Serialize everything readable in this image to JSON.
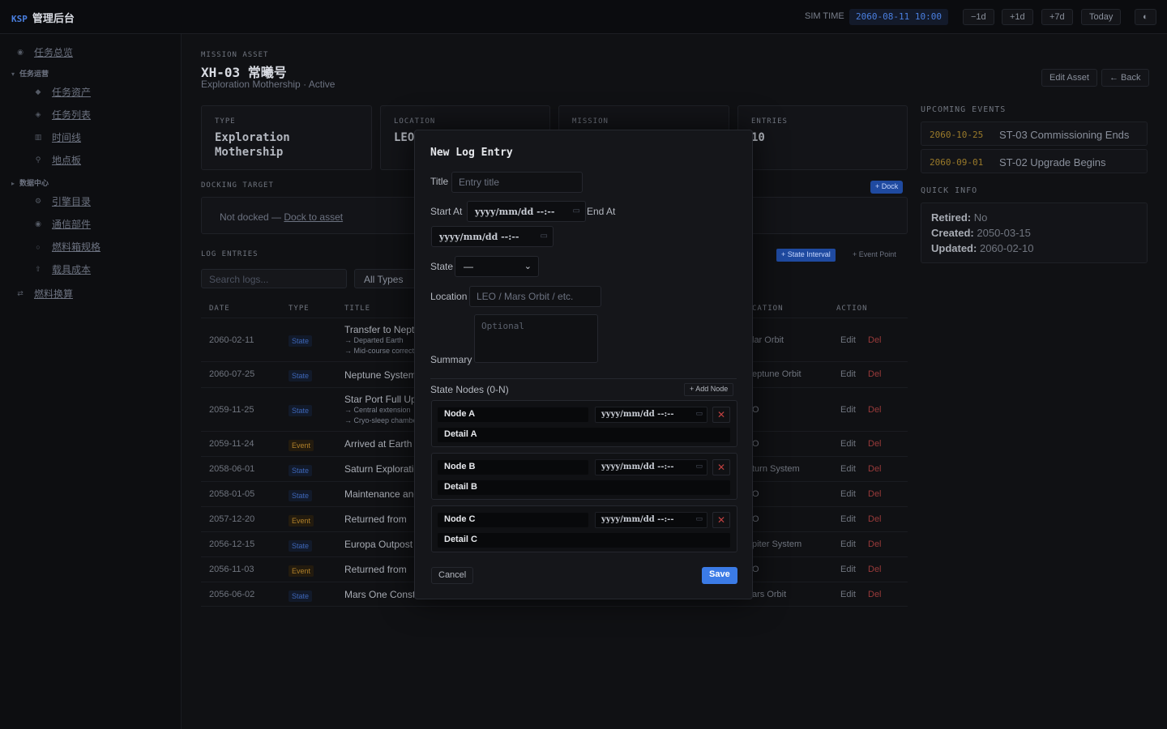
{
  "topbar": {
    "brand_code": "KSP",
    "brand_name": "管理后台",
    "sim_time_label": "SIM TIME",
    "sim_time": "2060-08-11 10:00",
    "buttons": [
      "−1d",
      "+1d",
      "+7d",
      "Today"
    ],
    "theme_icon": "◐"
  },
  "sidebar": {
    "overview": "任务总览",
    "group_ops": "任务运营",
    "ops_items": [
      "任务资产",
      "任务列表",
      "时间线",
      "地点板"
    ],
    "group_data": "数据中心",
    "data_items": [
      "引擎目录",
      "通信部件",
      "燃料箱规格",
      "载具成本"
    ],
    "fuel_calc": "燃料换算"
  },
  "header": {
    "eyebrow": "MISSION ASSET",
    "title": "XH-03 常曦号",
    "subtitle": "Exploration Mothership · Active",
    "edit_label": "Edit Asset",
    "back_label": "← Back"
  },
  "cards": [
    {
      "key": "TYPE",
      "value": "Exploration Mothership"
    },
    {
      "key": "LOCATION",
      "value": "LEO"
    },
    {
      "key": "MISSION",
      "value": ""
    },
    {
      "key": "ENTRIES",
      "value": "10"
    }
  ],
  "docking": {
    "heading": "DOCKING TARGET",
    "status": "Not docked — ",
    "link": "Dock to asset",
    "dock_button": "+ Dock"
  },
  "log": {
    "heading": "LOG ENTRIES",
    "search_placeholder": "Search logs...",
    "type_filter": "All Types",
    "state_interval_btn": "+ State Interval",
    "event_point_btn": "+ Event Point",
    "columns": {
      "date": "DATE",
      "type": "TYPE",
      "title": "TITLE",
      "location": "CATION",
      "action": "ACTION"
    },
    "edit_label": "Edit",
    "del_label": "Del",
    "rows": [
      {
        "date": "2060-02-11",
        "type": "State",
        "title": "Transfer to Neptune",
        "sub1": "→ Departed Earth",
        "sub2": "→ Mid-course correction",
        "location": "lar Orbit"
      },
      {
        "date": "2060-07-25",
        "type": "State",
        "title": "Neptune System",
        "sub1": "",
        "sub2": "",
        "location": "eptune Orbit"
      },
      {
        "date": "2059-11-25",
        "type": "State",
        "title": "Star Port Full Upgrade",
        "sub1": "→ Central extension",
        "sub2": "→ Cryo-sleep chamber",
        "location": "O"
      },
      {
        "date": "2059-11-24",
        "type": "Event",
        "title": "Arrived at Earth",
        "sub1": "",
        "sub2": "",
        "location": "O"
      },
      {
        "date": "2058-06-01",
        "type": "State",
        "title": "Saturn Exploration",
        "sub1": "",
        "sub2": "",
        "location": "turn System"
      },
      {
        "date": "2058-01-05",
        "type": "State",
        "title": "Maintenance and",
        "sub1": "",
        "sub2": "",
        "location": "O"
      },
      {
        "date": "2057-12-20",
        "type": "Event",
        "title": "Returned from",
        "sub1": "",
        "sub2": "",
        "location": "O"
      },
      {
        "date": "2056-12-15",
        "type": "State",
        "title": "Europa Outpost",
        "sub1": "",
        "sub2": "",
        "location": "piter System"
      },
      {
        "date": "2056-11-03",
        "type": "Event",
        "title": "Returned from",
        "sub1": "",
        "sub2": "",
        "location": "O"
      },
      {
        "date": "2056-06-02",
        "type": "State",
        "title": "Mars One Construction",
        "sub1": "",
        "sub2": "",
        "location": "ars Orbit"
      }
    ]
  },
  "upcoming": {
    "heading": "UPCOMING EVENTS",
    "items": [
      {
        "date": "2060-10-25",
        "title": "ST-03 Commissioning Ends"
      },
      {
        "date": "2060-09-01",
        "title": "ST-02 Upgrade Begins"
      }
    ]
  },
  "quick_info": {
    "heading": "QUICK INFO",
    "retired_label": "Retired:",
    "retired": "No",
    "created_label": "Created:",
    "created": "2050-03-15",
    "updated_label": "Updated:",
    "updated": "2060-02-10"
  },
  "modal": {
    "title": "New Log Entry",
    "title_label": "Title",
    "title_placeholder": "Entry title",
    "start_label": "Start At",
    "end_label": "End At",
    "date_placeholder": "yyyy/mm/dd --:--",
    "state_label": "State",
    "state_value": "—",
    "location_label": "Location",
    "location_placeholder": "LEO / Mars Orbit / etc.",
    "summary_label": "Summary",
    "summary_placeholder": "Optional",
    "nodes_label": "State Nodes (0-N)",
    "add_node": "+ Add Node",
    "nodes": [
      {
        "name": "Node A",
        "detail": "Detail A"
      },
      {
        "name": "Node B",
        "detail": "Detail B"
      },
      {
        "name": "Node C",
        "detail": "Detail C"
      }
    ],
    "cancel_label": "Cancel",
    "save_label": "Save"
  }
}
